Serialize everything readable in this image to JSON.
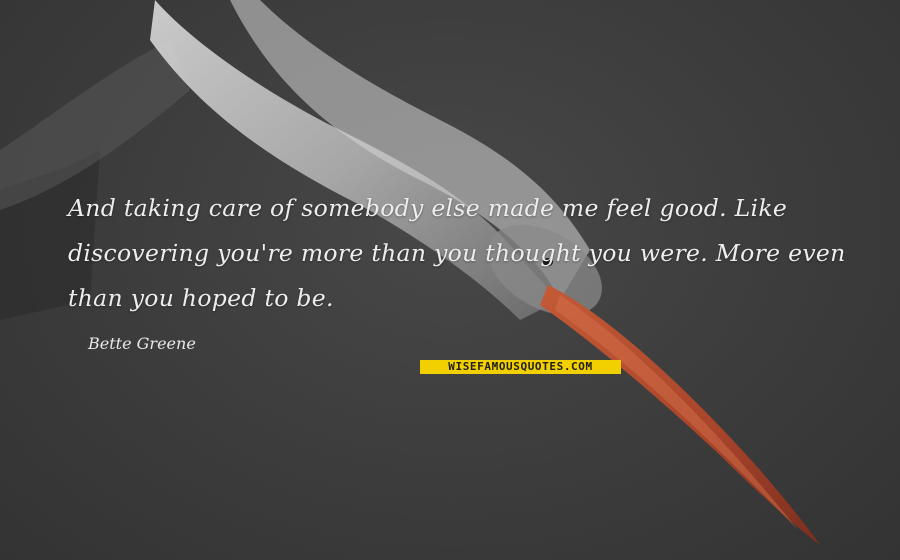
{
  "quote": {
    "text": "And taking care of somebody else made me feel good. Like discovering you're more than you thought you were. More even than you hoped to be.",
    "author": "Bette Greene"
  },
  "watermark": "WISEFAMOUSQUOTES.COM",
  "colors": {
    "background": "#3d3d3d",
    "text": "#ededed",
    "badge_bg": "#f2d000",
    "badge_text": "#1e1e1e",
    "beak": "#b04a2a"
  }
}
